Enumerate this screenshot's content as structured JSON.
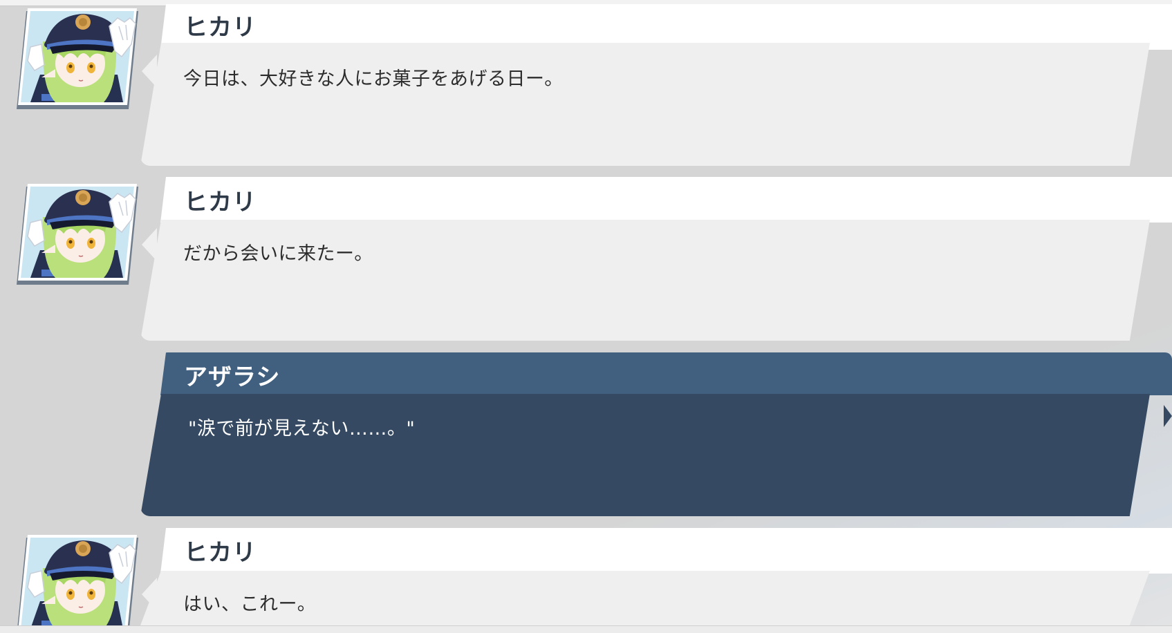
{
  "conversation": {
    "messages": [
      {
        "speaker": "ヒカリ",
        "text": "今日は、大好きな人にお菓子をあげる日ー。",
        "avatar": "hikari-avatar"
      },
      {
        "speaker": "ヒカリ",
        "text": "だから会いに来たー。",
        "avatar": "hikari-avatar"
      },
      {
        "speaker": "アザラシ",
        "text": "\"涙で前が見えない……。\""
      },
      {
        "speaker": "ヒカリ",
        "text": "はい、これー。",
        "avatar": "hikari-avatar"
      }
    ]
  },
  "colors": {
    "npc_name_bar": "#ffffff",
    "npc_bubble": "#efefef",
    "player_name_bar": "#41607f",
    "player_bubble": "#354a62",
    "background": "#d5d5d5"
  }
}
